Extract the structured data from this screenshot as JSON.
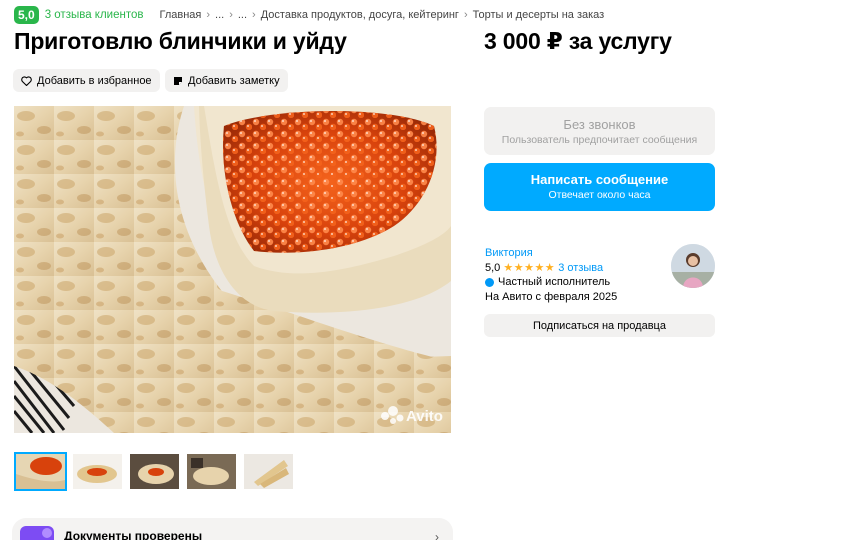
{
  "header": {
    "rating": "5,0",
    "reviews_link": "3 отзыва клиентов",
    "breadcrumbs": [
      "Главная",
      "...",
      "...",
      "Доставка продуктов, досуга, кейтеринг",
      "Торты и десерты на заказ"
    ]
  },
  "listing": {
    "title": "Приготовлю блинчики и уйду",
    "price": "3 000 ₽ за услугу",
    "favorite_label": "Добавить в избранное",
    "note_label": "Добавить заметку",
    "watermark": "Avito"
  },
  "contact": {
    "no_calls_title": "Без звонков",
    "no_calls_subtitle": "Пользователь предпочитает сообщения",
    "message_title": "Написать сообщение",
    "message_subtitle": "Отвечает около часа"
  },
  "seller": {
    "name": "Виктория",
    "rating": "5,0",
    "stars": "★★★★★",
    "reviews": "3 отзыва",
    "type": "Частный исполнитель",
    "since": "На Авито с февраля 2025",
    "subscribe_label": "Подписаться на продавца"
  },
  "docs": {
    "label": "Документы проверены"
  },
  "colors": {
    "accent": "#00aaff",
    "rating_green": "#2ab64b",
    "link_blue": "#0099f7",
    "star": "#ffb021"
  },
  "icons": [
    "heart-icon",
    "note-icon",
    "avito-logo-icon",
    "verified-icon",
    "chevron-right-icon",
    "document-icon"
  ]
}
